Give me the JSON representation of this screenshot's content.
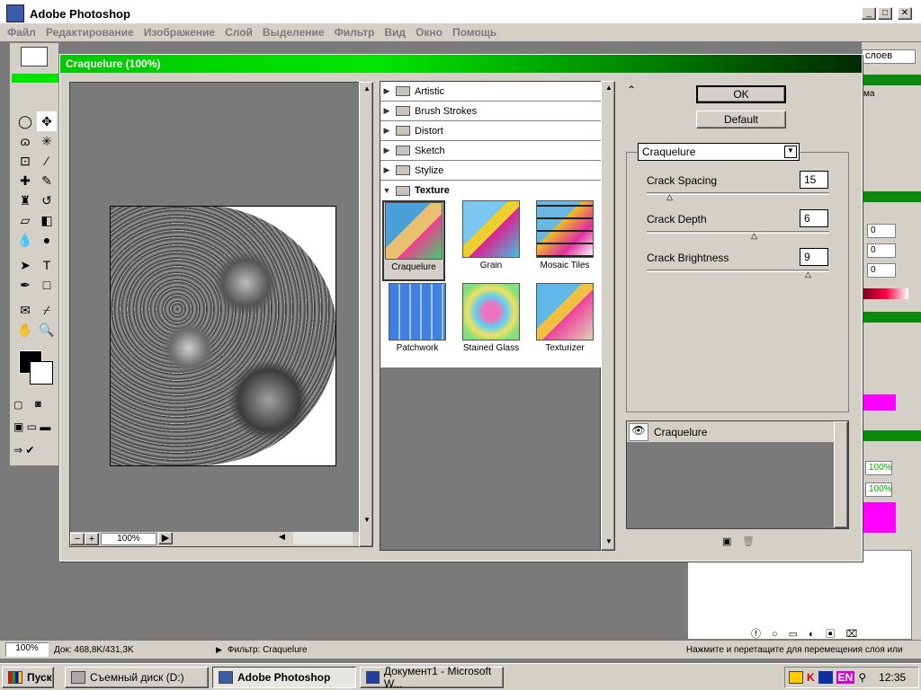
{
  "app": {
    "title": "Adobe Photoshop"
  },
  "menu": [
    "Файл",
    "Редактирование",
    "Изображение",
    "Слой",
    "Выделение",
    "Фильтр",
    "Вид",
    "Окно",
    "Помощь"
  ],
  "right_panel": {
    "tab": "слоев",
    "item": "ма",
    "fields": [
      "0",
      "0",
      "0"
    ],
    "zoom_fields": [
      "100%",
      "100%"
    ]
  },
  "dialog": {
    "title": "Craquelure (100%)",
    "zoom": "100%",
    "categories": [
      "Artistic",
      "Brush Strokes",
      "Distort",
      "Sketch",
      "Stylize",
      "Texture"
    ],
    "texture_filters": [
      "Craquelure",
      "Grain",
      "Mosaic Tiles",
      "Patchwork",
      "Stained Glass",
      "Texturizer"
    ],
    "selected_filter": "Craquelure",
    "ok": "OK",
    "default": "Default",
    "select_value": "Craquelure",
    "params": [
      {
        "label": "Crack Spacing",
        "value": "15"
      },
      {
        "label": "Crack Depth",
        "value": "6"
      },
      {
        "label": "Crack Brightness",
        "value": "9"
      }
    ],
    "effect_layer": "Craquelure",
    "colors": {
      "title_start": "#00c800",
      "title_end": "#002800"
    }
  },
  "status": {
    "zoom": "100%",
    "doc": "Док: 468,8K/431,3K",
    "filter": "Фильтр: Craquelure",
    "hint": "Нажмите и перетащите для перемещения слоя или"
  },
  "taskbar": {
    "start": "Пуск",
    "items": [
      "Съемный диск (D:)",
      "Adobe Photoshop",
      "Документ1 - Microsoft W..."
    ],
    "lang": "EN",
    "clock": "12:35"
  }
}
